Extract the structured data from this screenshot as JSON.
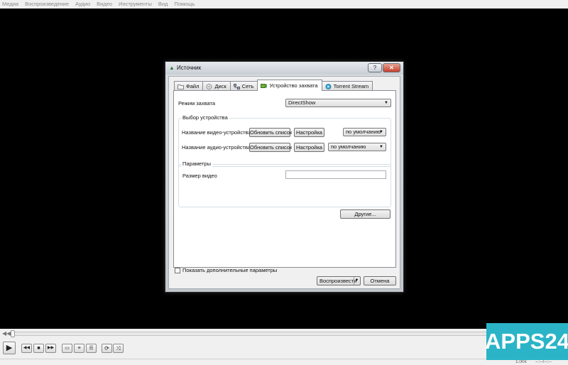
{
  "menu": [
    "Медиа",
    "Воспроизведение",
    "Аудио",
    "Видео",
    "Инструменты",
    "Вид",
    "Помощь"
  ],
  "dialog": {
    "title": "Источник",
    "help": "?",
    "close": "✕",
    "tabs": [
      {
        "label": "Файл",
        "icon": "folder-icon"
      },
      {
        "label": "Диск",
        "icon": "disc-icon"
      },
      {
        "label": "Сеть",
        "icon": "network-icon"
      },
      {
        "label": "Устройство захвата",
        "icon": "capture-device-icon",
        "active": true
      },
      {
        "label": "Torrent Stream",
        "icon": "torrent-icon"
      }
    ],
    "capture_mode_label": "Режим захвата",
    "capture_mode_value": "DirectShow",
    "device_group_title": "Выбор устройства",
    "video_device_label": "Название видео-устройства",
    "audio_device_label": "Название аудио-устройства",
    "refresh_label": "Обновить список",
    "settings_label": "Настройка",
    "default_value": "по умолчанию",
    "params_group_title": "Параметры",
    "video_size_label": "Размер видео",
    "video_size_value": "",
    "more_label": "Другие...",
    "show_more_label": "Показать дополнительные параметры",
    "play_label": "Воспроизвести",
    "cancel_label": "Отмена"
  },
  "status": {
    "speed": "1.00x",
    "time": "--:--/--:--"
  },
  "watermark": "APPS24",
  "colors": {
    "accent": "#2bb4c7",
    "close": "#c4402c"
  }
}
